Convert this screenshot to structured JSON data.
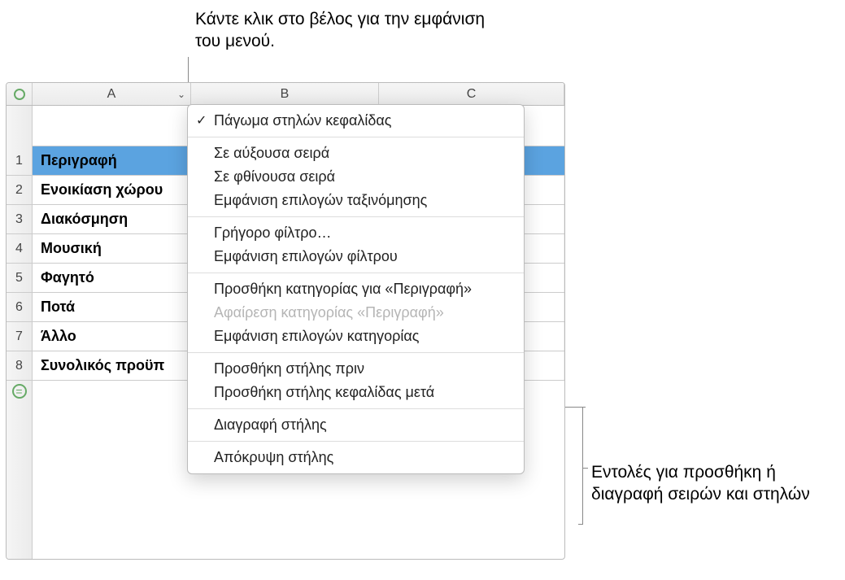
{
  "callouts": {
    "top": "Κάντε κλικ στο βέλος για την εμφάνιση του μενού.",
    "bottom": "Εντολές για προσθήκη ή διαγραφή σειρών και στηλών"
  },
  "columns": {
    "a": "A",
    "b": "B",
    "c": "C"
  },
  "row_labels": [
    "1",
    "2",
    "3",
    "4",
    "5",
    "6",
    "7",
    "8"
  ],
  "cells": {
    "r1a": "Περιγραφή",
    "r2a": "Ενοικίαση χώρου",
    "r3a": "Διακόσμηση",
    "r4a": "Μουσική",
    "r5a": "Φαγητό",
    "r6a": "Ποτά",
    "r7a": "Άλλο",
    "r8a": "Συνολικός προϋπ"
  },
  "menu": {
    "freeze": "Πάγωμα στηλών κεφαλίδας",
    "asc": "Σε αύξουσα σειρά",
    "desc": "Σε φθίνουσα σειρά",
    "sort_opts": "Εμφάνιση επιλογών ταξινόμησης",
    "quick_filter": "Γρήγορο φίλτρο…",
    "filter_opts": "Εμφάνιση επιλογών φίλτρου",
    "add_cat": "Προσθήκη κατηγορίας για «Περιγραφή»",
    "remove_cat": "Αφαίρεση κατηγορίας «Περιγραφή»",
    "cat_opts": "Εμφάνιση επιλογών κατηγορίας",
    "add_before": "Προσθήκη στήλης πριν",
    "add_after": "Προσθήκη στήλης κεφαλίδας μετά",
    "delete_col": "Διαγραφή στήλης",
    "hide_col": "Απόκρυψη στήλης"
  },
  "icons": {
    "checkmark": "✓",
    "arrow_down": "⌄",
    "row_add": "="
  }
}
